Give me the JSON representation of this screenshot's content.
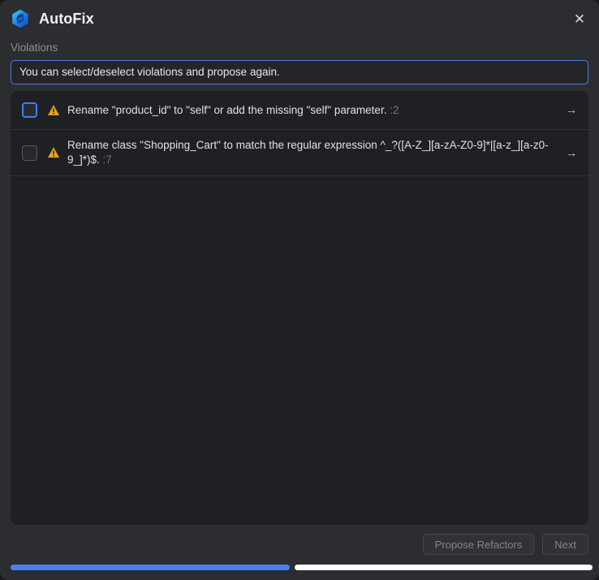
{
  "window": {
    "title": "AutoFix",
    "logo_icon": "autofix-swirl-logo",
    "close_icon": "close-icon"
  },
  "section": {
    "label": "Violations"
  },
  "banner": {
    "text": "You can select/deselect violations and propose again.",
    "border_color": "#4a7dde"
  },
  "violations": [
    {
      "checked": false,
      "focused": true,
      "severity_icon": "warning-triangle-icon",
      "text": "Rename \"product_id\" to \"self\" or add the missing \"self\" parameter.",
      "location": ":2",
      "action_icon": "arrow-right-icon"
    },
    {
      "checked": false,
      "focused": false,
      "severity_icon": "warning-triangle-icon",
      "text": "Rename class \"Shopping_Cart\" to match the regular expression ^_?([A-Z_][a-zA-Z0-9]*|[a-z_][a-z0-9_]*)$.",
      "location": ":7",
      "action_icon": "arrow-right-icon"
    }
  ],
  "footer": {
    "propose_label": "Propose Refactors",
    "next_label": "Next"
  },
  "progress": {
    "percent": 48,
    "fill_color": "#4a80f0",
    "track_color": "#ffffff"
  },
  "colors": {
    "window_bg": "#2b2d31",
    "panel_bg": "#1e2024",
    "accent": "#3d7eff",
    "warning": "#e8a220",
    "text_primary": "#dfe1e5",
    "text_muted": "#71757d"
  }
}
